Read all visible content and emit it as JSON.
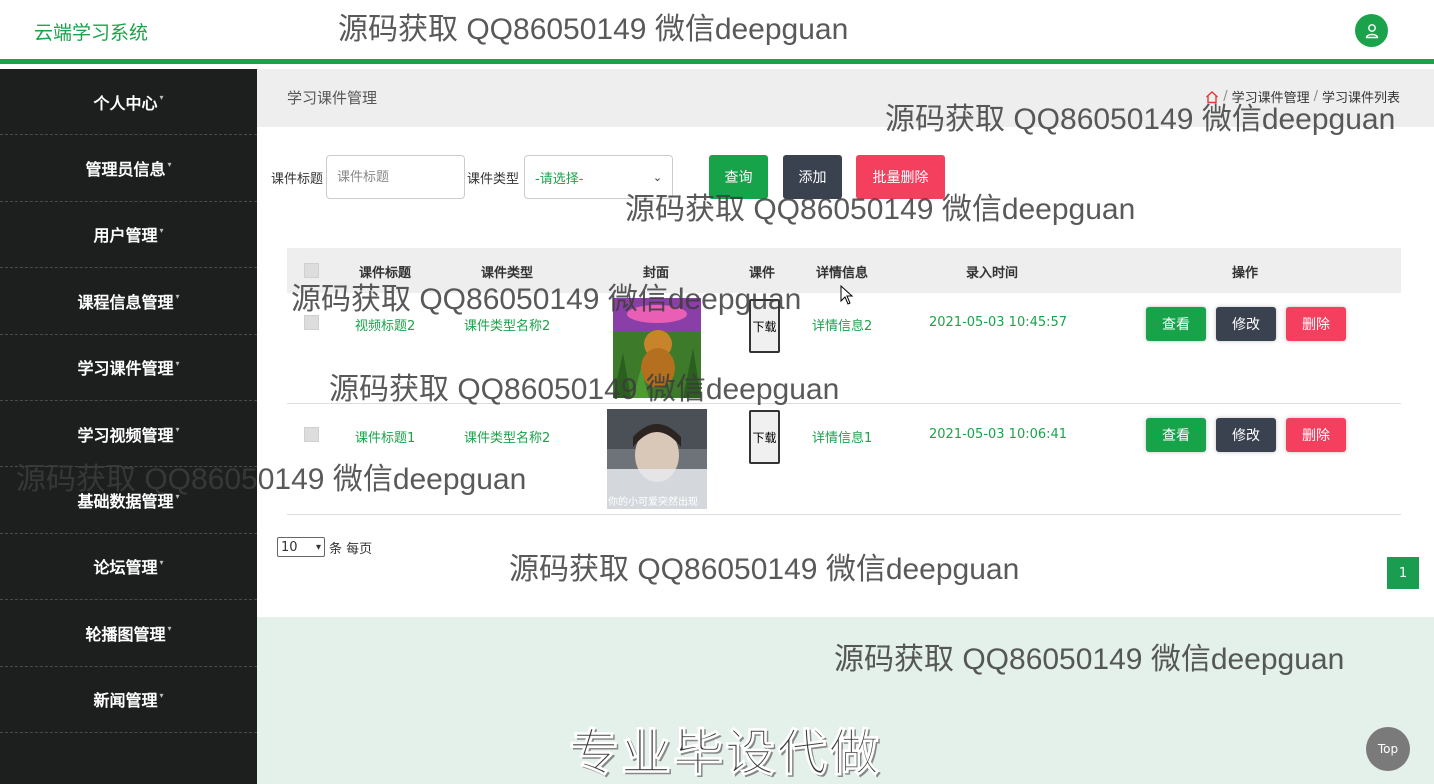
{
  "app": {
    "brand": "云端学习系统"
  },
  "sidebar": {
    "items": [
      {
        "label": "个人中心"
      },
      {
        "label": "管理员信息"
      },
      {
        "label": "用户管理"
      },
      {
        "label": "课程信息管理"
      },
      {
        "label": "学习课件管理"
      },
      {
        "label": "学习视频管理"
      },
      {
        "label": "基础数据管理"
      },
      {
        "label": "论坛管理"
      },
      {
        "label": "轮播图管理"
      },
      {
        "label": "新闻管理"
      }
    ]
  },
  "main": {
    "page_title": "学习课件管理",
    "breadcrumb": [
      "学习课件管理",
      "学习课件列表"
    ]
  },
  "search": {
    "title_label": "课件标题",
    "title_placeholder": "课件标题",
    "type_label": "课件类型",
    "type_selected": "-请选择-",
    "query_btn": "查询",
    "add_btn": "添加",
    "batch_delete_btn": "批量删除"
  },
  "table": {
    "columns": [
      "课件标题",
      "课件类型",
      "封面",
      "课件",
      "详情信息",
      "录入时间",
      "操作"
    ],
    "rows": [
      {
        "title": "视频标题2",
        "type": "课件类型名称2",
        "download": "下载",
        "detail": "详情信息2",
        "time": "2021-05-03 10:45:57",
        "cover_caption": ""
      },
      {
        "title": "课件标题1",
        "type": "课件类型名称2",
        "download": "下载",
        "detail": "详情信息1",
        "time": "2021-05-03 10:06:41",
        "cover_caption": "你的小可爱突然出现"
      }
    ],
    "actions": {
      "view": "查看",
      "edit": "修改",
      "delete": "删除"
    }
  },
  "pager": {
    "page_size": "10",
    "per_page_text": "条 每页",
    "current_page": "1"
  },
  "promo": "专业毕设代做",
  "top_btn": "Top",
  "watermark": "源码获取 QQ86050149 微信deepguan",
  "colors": {
    "accent": "#1aa34a",
    "sidebar_bg": "#1d1f1e",
    "danger": "#f43f5e",
    "dark_btn": "#3a4250"
  }
}
